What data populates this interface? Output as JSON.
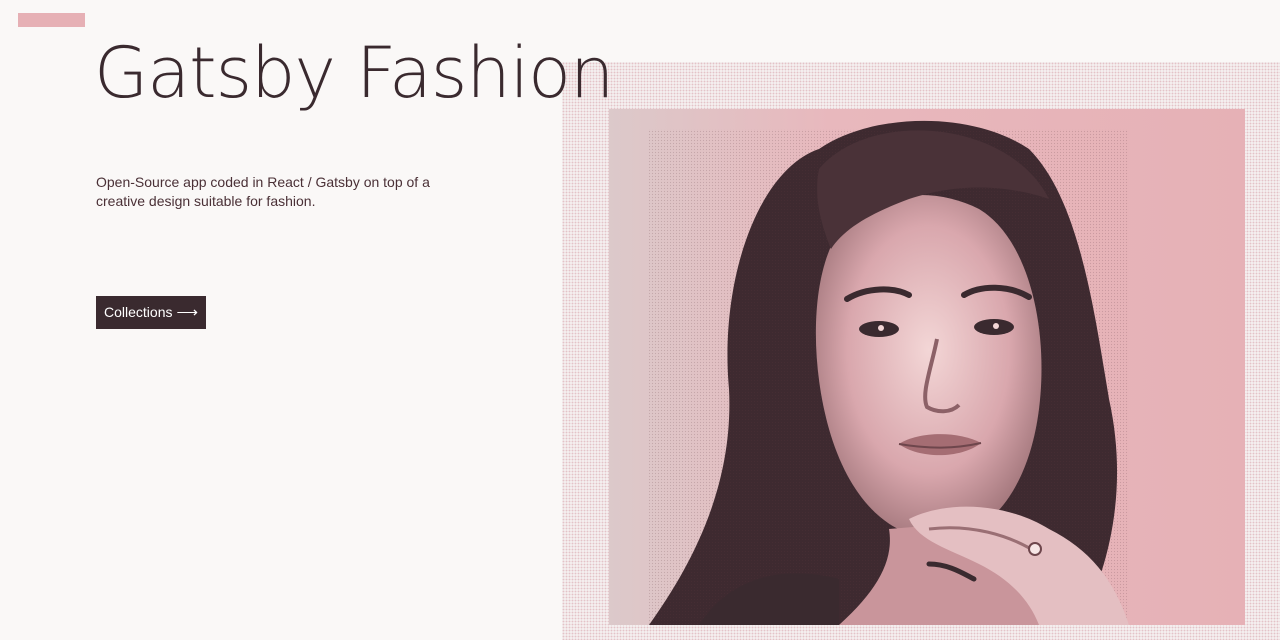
{
  "brand": {
    "title": "Gatsby Fashion",
    "accent_color": "#e6b0b5",
    "text_color": "#3a2a2f"
  },
  "intro": {
    "description": "Open-Source app coded in React / Gatsby on top of a creative design suitable for fashion."
  },
  "cta": {
    "label": "Collections",
    "arrow": "⟶"
  },
  "hero": {
    "image_subject": "portrait-photo"
  }
}
